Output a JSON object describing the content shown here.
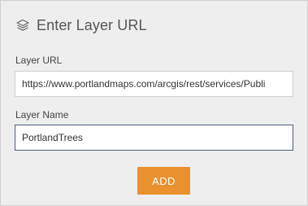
{
  "dialog": {
    "title": "Enter Layer URL",
    "icon": "layers-icon"
  },
  "form": {
    "layer_url_label": "Layer URL",
    "layer_url_value": "https://www.portlandmaps.com/arcgis/rest/services/Publi",
    "layer_name_label": "Layer Name",
    "layer_name_value": "PortlandTrees",
    "add_button_label": "ADD"
  },
  "colors": {
    "panel_background": "#eeeeee",
    "button_accent": "#e8912d",
    "focused_border": "#4a5f79"
  }
}
